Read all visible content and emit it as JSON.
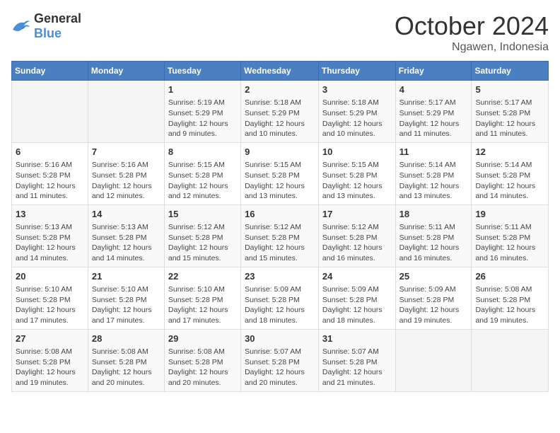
{
  "header": {
    "logo_general": "General",
    "logo_blue": "Blue",
    "month_title": "October 2024",
    "location": "Ngawen, Indonesia"
  },
  "days_of_week": [
    "Sunday",
    "Monday",
    "Tuesday",
    "Wednesday",
    "Thursday",
    "Friday",
    "Saturday"
  ],
  "weeks": [
    [
      {
        "day": "",
        "info": ""
      },
      {
        "day": "",
        "info": ""
      },
      {
        "day": "1",
        "info": "Sunrise: 5:19 AM\nSunset: 5:29 PM\nDaylight: 12 hours and 9 minutes."
      },
      {
        "day": "2",
        "info": "Sunrise: 5:18 AM\nSunset: 5:29 PM\nDaylight: 12 hours and 10 minutes."
      },
      {
        "day": "3",
        "info": "Sunrise: 5:18 AM\nSunset: 5:29 PM\nDaylight: 12 hours and 10 minutes."
      },
      {
        "day": "4",
        "info": "Sunrise: 5:17 AM\nSunset: 5:29 PM\nDaylight: 12 hours and 11 minutes."
      },
      {
        "day": "5",
        "info": "Sunrise: 5:17 AM\nSunset: 5:28 PM\nDaylight: 12 hours and 11 minutes."
      }
    ],
    [
      {
        "day": "6",
        "info": "Sunrise: 5:16 AM\nSunset: 5:28 PM\nDaylight: 12 hours and 11 minutes."
      },
      {
        "day": "7",
        "info": "Sunrise: 5:16 AM\nSunset: 5:28 PM\nDaylight: 12 hours and 12 minutes."
      },
      {
        "day": "8",
        "info": "Sunrise: 5:15 AM\nSunset: 5:28 PM\nDaylight: 12 hours and 12 minutes."
      },
      {
        "day": "9",
        "info": "Sunrise: 5:15 AM\nSunset: 5:28 PM\nDaylight: 12 hours and 13 minutes."
      },
      {
        "day": "10",
        "info": "Sunrise: 5:15 AM\nSunset: 5:28 PM\nDaylight: 12 hours and 13 minutes."
      },
      {
        "day": "11",
        "info": "Sunrise: 5:14 AM\nSunset: 5:28 PM\nDaylight: 12 hours and 13 minutes."
      },
      {
        "day": "12",
        "info": "Sunrise: 5:14 AM\nSunset: 5:28 PM\nDaylight: 12 hours and 14 minutes."
      }
    ],
    [
      {
        "day": "13",
        "info": "Sunrise: 5:13 AM\nSunset: 5:28 PM\nDaylight: 12 hours and 14 minutes."
      },
      {
        "day": "14",
        "info": "Sunrise: 5:13 AM\nSunset: 5:28 PM\nDaylight: 12 hours and 14 minutes."
      },
      {
        "day": "15",
        "info": "Sunrise: 5:12 AM\nSunset: 5:28 PM\nDaylight: 12 hours and 15 minutes."
      },
      {
        "day": "16",
        "info": "Sunrise: 5:12 AM\nSunset: 5:28 PM\nDaylight: 12 hours and 15 minutes."
      },
      {
        "day": "17",
        "info": "Sunrise: 5:12 AM\nSunset: 5:28 PM\nDaylight: 12 hours and 16 minutes."
      },
      {
        "day": "18",
        "info": "Sunrise: 5:11 AM\nSunset: 5:28 PM\nDaylight: 12 hours and 16 minutes."
      },
      {
        "day": "19",
        "info": "Sunrise: 5:11 AM\nSunset: 5:28 PM\nDaylight: 12 hours and 16 minutes."
      }
    ],
    [
      {
        "day": "20",
        "info": "Sunrise: 5:10 AM\nSunset: 5:28 PM\nDaylight: 12 hours and 17 minutes."
      },
      {
        "day": "21",
        "info": "Sunrise: 5:10 AM\nSunset: 5:28 PM\nDaylight: 12 hours and 17 minutes."
      },
      {
        "day": "22",
        "info": "Sunrise: 5:10 AM\nSunset: 5:28 PM\nDaylight: 12 hours and 17 minutes."
      },
      {
        "day": "23",
        "info": "Sunrise: 5:09 AM\nSunset: 5:28 PM\nDaylight: 12 hours and 18 minutes."
      },
      {
        "day": "24",
        "info": "Sunrise: 5:09 AM\nSunset: 5:28 PM\nDaylight: 12 hours and 18 minutes."
      },
      {
        "day": "25",
        "info": "Sunrise: 5:09 AM\nSunset: 5:28 PM\nDaylight: 12 hours and 19 minutes."
      },
      {
        "day": "26",
        "info": "Sunrise: 5:08 AM\nSunset: 5:28 PM\nDaylight: 12 hours and 19 minutes."
      }
    ],
    [
      {
        "day": "27",
        "info": "Sunrise: 5:08 AM\nSunset: 5:28 PM\nDaylight: 12 hours and 19 minutes."
      },
      {
        "day": "28",
        "info": "Sunrise: 5:08 AM\nSunset: 5:28 PM\nDaylight: 12 hours and 20 minutes."
      },
      {
        "day": "29",
        "info": "Sunrise: 5:08 AM\nSunset: 5:28 PM\nDaylight: 12 hours and 20 minutes."
      },
      {
        "day": "30",
        "info": "Sunrise: 5:07 AM\nSunset: 5:28 PM\nDaylight: 12 hours and 20 minutes."
      },
      {
        "day": "31",
        "info": "Sunrise: 5:07 AM\nSunset: 5:28 PM\nDaylight: 12 hours and 21 minutes."
      },
      {
        "day": "",
        "info": ""
      },
      {
        "day": "",
        "info": ""
      }
    ]
  ]
}
